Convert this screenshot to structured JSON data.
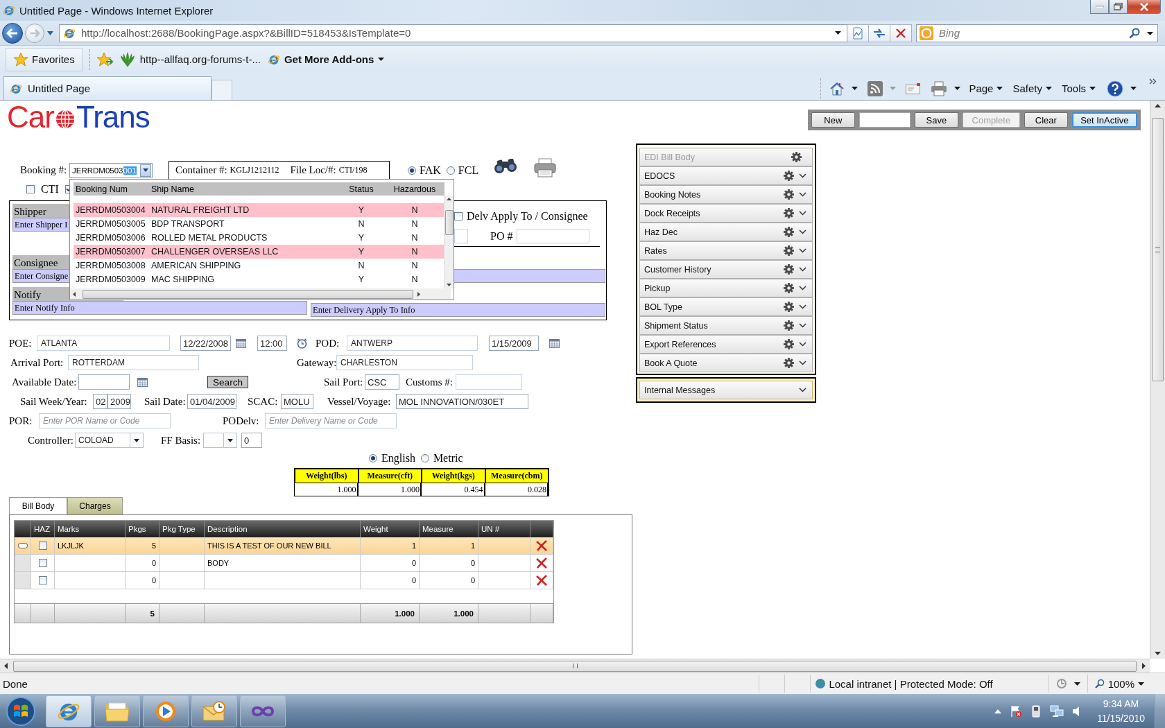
{
  "window": {
    "title": "Untitled Page - Windows Internet Explorer"
  },
  "address_bar": {
    "url": "http://localhost:2688/BookingPage.aspx?&BillID=518453&IsTemplate=0"
  },
  "search_box": {
    "placeholder": "Bing"
  },
  "favorites_bar": {
    "items": [
      {
        "kind": "favorites",
        "label": "Favorites"
      },
      {
        "kind": "link",
        "label": "http--allfaq.org-forums-t-..."
      },
      {
        "kind": "gallery",
        "label": "Get More Add-ons"
      }
    ]
  },
  "tabs": [
    {
      "label": "Untitled Page",
      "selected": true
    }
  ],
  "command_bar": [
    "Page",
    "Safety",
    "Tools"
  ],
  "logo": {
    "left": "Car",
    "right": "Trans"
  },
  "toolbar": {
    "items": [
      {
        "kind": "button",
        "label": "New",
        "disabled": false,
        "focused": false
      },
      {
        "kind": "field"
      },
      {
        "kind": "button",
        "label": "Save",
        "disabled": false,
        "focused": false
      },
      {
        "kind": "button",
        "label": "Complete",
        "disabled": true,
        "focused": false
      },
      {
        "kind": "button",
        "label": "Clear",
        "disabled": false,
        "focused": false
      },
      {
        "kind": "button",
        "label": "Set InActive",
        "disabled": false,
        "focused": true
      }
    ]
  },
  "booking": {
    "label": "Booking #:",
    "value": "JERRDM0503",
    "selected_text": "001"
  },
  "container_info": {
    "container_label": "Container #:",
    "container": "KGLJ1212112",
    "file_loc_label": "File Loc/#:",
    "file_loc": "CTI/198"
  },
  "freight_type": [
    {
      "label": "FAK",
      "selected": true
    },
    {
      "label": "FCL",
      "selected": false
    }
  ],
  "cti": {
    "label": "CTI",
    "checked": false
  },
  "second_checkbox": {
    "checked": true
  },
  "parties": {
    "shipper": {
      "label": "Shipper",
      "value": "Enter Shipper I"
    },
    "consignee": {
      "label": "Consignee",
      "value": "Enter Consigne"
    },
    "notify": {
      "label": "Notify",
      "value": "Enter Notify Info"
    },
    "delivery_apply_to": {
      "value": "Enter Delivery Apply To Info"
    },
    "delv_apply": {
      "label": "Delv Apply To / Consignee",
      "checked": false
    },
    "po": {
      "label": "PO #"
    }
  },
  "booking_dropdown": {
    "columns": [
      "Booking Num",
      "Ship Name",
      "Status",
      "Hazardous"
    ],
    "rows": [
      {
        "booking": "JERRDM0503004",
        "ship_name": "NATURAL FREIGHT LTD",
        "status": "Y",
        "hazardous": "N",
        "highlighted": true
      },
      {
        "booking": "JERRDM0503005",
        "ship_name": "BDP TRANSPORT",
        "status": "N",
        "hazardous": "N",
        "highlighted": false
      },
      {
        "booking": "JERRDM0503006",
        "ship_name": "ROLLED METAL PRODUCTS",
        "status": "Y",
        "hazardous": "N",
        "highlighted": false
      },
      {
        "booking": "JERRDM0503007",
        "ship_name": "CHALLENGER OVERSEAS LLC",
        "status": "Y",
        "hazardous": "N",
        "highlighted": true
      },
      {
        "booking": "JERRDM0503008",
        "ship_name": "AMERICAN SHIPPING",
        "status": "N",
        "hazardous": "N",
        "highlighted": false
      },
      {
        "booking": "JERRDM0503009",
        "ship_name": "MAC SHIPPING",
        "status": "Y",
        "hazardous": "N",
        "highlighted": false
      }
    ]
  },
  "form": {
    "poe": {
      "label": "POE:",
      "value": "ATLANTA",
      "date": "12/22/2008",
      "time": "12:00"
    },
    "pod": {
      "label": "POD:",
      "value": "ANTWERP",
      "date": "1/15/2009"
    },
    "arrival_port": {
      "label": "Arrival Port:",
      "value": "ROTTERDAM"
    },
    "gateway": {
      "label": "Gateway:",
      "value": "CHARLESTON"
    },
    "available_date": {
      "label": "Available Date:"
    },
    "search_button": "Search",
    "sail_port": {
      "label": "Sail Port:",
      "value": "CSC"
    },
    "customs": {
      "label": "Customs #:"
    },
    "sail_week_year": {
      "label": "Sail Week/Year:",
      "week": "02",
      "year": "2009"
    },
    "sail_date": {
      "label": "Sail Date:",
      "value": "01/04/2009"
    },
    "scac": {
      "label": "SCAC:",
      "value": "MOLU"
    },
    "vessel_voyage": {
      "label": "Vessel/Voyage:",
      "value": "MOL INNOVATION/030ET"
    },
    "por": {
      "label": "POR:",
      "placeholder": "Enter POR Name or Code"
    },
    "podelv": {
      "label": "PODelv:",
      "placeholder": "Enter Delivery Name or Code"
    },
    "controller": {
      "label": "Controller:",
      "value": "COLOAD"
    },
    "ff_basis": {
      "label": "FF Basis:",
      "amount": "0"
    }
  },
  "units": [
    {
      "label": "English",
      "selected": true
    },
    {
      "label": "Metric",
      "selected": false
    }
  ],
  "totals_table": {
    "columns": [
      "Weight(lbs)",
      "Measure(cft)",
      "Weight(kgs)",
      "Measure(cbm)"
    ],
    "values": [
      "1.000",
      "1.000",
      "0.454",
      "0.028"
    ]
  },
  "bill_tabs": [
    {
      "label": "Bill Body",
      "selected": true
    },
    {
      "label": "Charges",
      "selected": false
    }
  ],
  "bill_table": {
    "columns": [
      "HAZ",
      "Marks",
      "Pkgs",
      "Pkg Type",
      "Description",
      "Weight",
      "Measure",
      "UN #"
    ],
    "rows": [
      {
        "selected": true,
        "haz": false,
        "marks": "LKJLJK",
        "pkgs": "5",
        "description": "THIS IS A TEST OF OUR NEW BILL",
        "weight": "1",
        "measure": "1"
      },
      {
        "selected": false,
        "haz": false,
        "pkgs": "0",
        "description": "BODY",
        "weight": "0",
        "measure": "0"
      },
      {
        "selected": false,
        "haz": false,
        "pkgs": "0",
        "weight": "0",
        "measure": "0"
      }
    ],
    "footer": {
      "pkgs": "5",
      "weight": "1.000",
      "measure": "1.000"
    }
  },
  "side_panel": {
    "items": [
      {
        "label": "EDI Bill Body",
        "disabled": true,
        "expandable": false
      },
      {
        "label": "EDOCS",
        "disabled": false,
        "expandable": true
      },
      {
        "label": "Booking Notes",
        "disabled": false,
        "expandable": true
      },
      {
        "label": "Dock Receipts",
        "disabled": false,
        "expandable": true
      },
      {
        "label": "Haz Dec",
        "disabled": false,
        "expandable": true
      },
      {
        "label": "Rates",
        "disabled": false,
        "expandable": true
      },
      {
        "label": "Customer History",
        "disabled": false,
        "expandable": true
      },
      {
        "label": "Pickup",
        "disabled": false,
        "expandable": true
      },
      {
        "label": "BOL Type",
        "disabled": false,
        "expandable": true
      },
      {
        "label": "Shipment Status",
        "disabled": false,
        "expandable": true
      },
      {
        "label": "Export References",
        "disabled": false,
        "expandable": true
      },
      {
        "label": "Book A Quote",
        "disabled": false,
        "expandable": true
      }
    ],
    "messages": {
      "label": "Internal Messages"
    }
  },
  "status_bar": {
    "text": "Done",
    "zone": "Local intranet | Protected Mode: Off",
    "zoom": "100%"
  },
  "taskbar": {
    "time": "9:34 AM",
    "date": "11/15/2010"
  }
}
